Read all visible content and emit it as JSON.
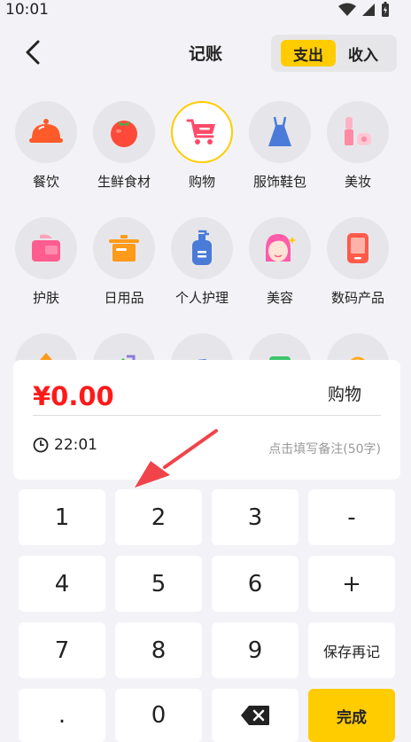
{
  "status": {
    "time": "10:01"
  },
  "header": {
    "title": "记账",
    "back_icon": "chevron-left-icon",
    "toggle": {
      "expense_label": "支出",
      "income_label": "收入",
      "selected": "expense"
    }
  },
  "categories": [
    {
      "label": "餐饮",
      "icon": "food-cover-icon"
    },
    {
      "label": "生鲜食材",
      "icon": "tomato-icon"
    },
    {
      "label": "购物",
      "icon": "shopping-cart-icon",
      "selected": true
    },
    {
      "label": "服饰鞋包",
      "icon": "dress-icon"
    },
    {
      "label": "美妆",
      "icon": "lipstick-icon"
    },
    {
      "label": "护肤",
      "icon": "skincare-jar-icon"
    },
    {
      "label": "日用品",
      "icon": "pot-icon"
    },
    {
      "label": "个人护理",
      "icon": "lotion-bottle-icon"
    },
    {
      "label": "美容",
      "icon": "beauty-face-icon"
    },
    {
      "label": "数码产品",
      "icon": "phone-icon"
    }
  ],
  "entry": {
    "amount": "¥0.00",
    "category": "购物",
    "time": "22:01",
    "note_placeholder": "点击填写备注(50字)"
  },
  "keypad": {
    "keys": [
      "1",
      "2",
      "3",
      "-",
      "4",
      "5",
      "6",
      "+",
      "7",
      "8",
      "9",
      "保存再记",
      ".",
      "0",
      "",
      "完成"
    ]
  },
  "colors": {
    "accent": "#ffcc00",
    "amount": "#ff1a1a",
    "arrow": "#f0444a"
  }
}
